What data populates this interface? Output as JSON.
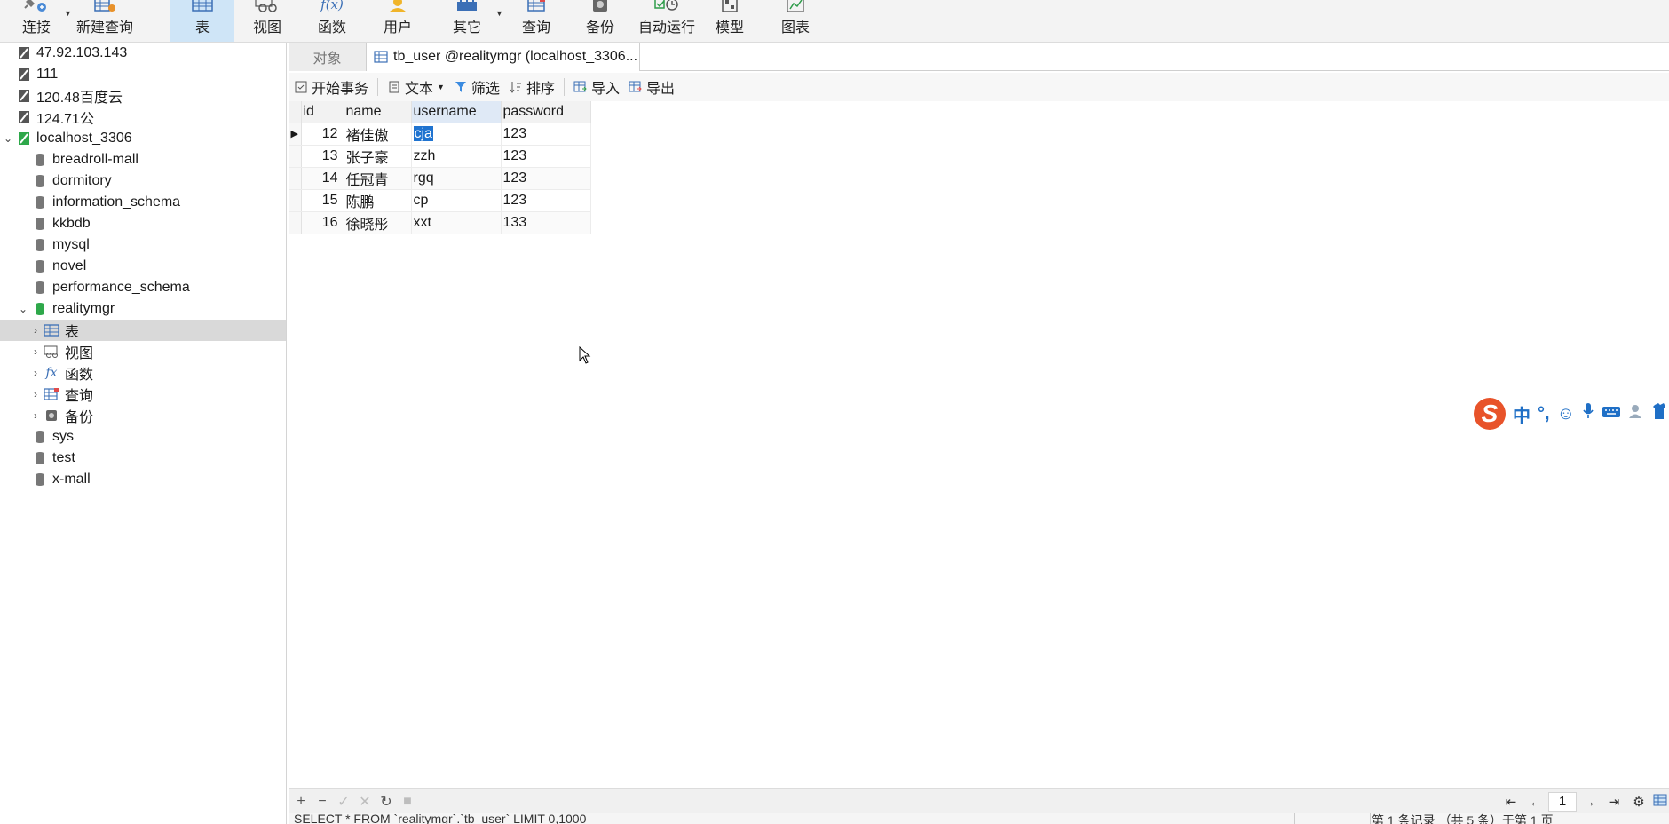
{
  "toolbar": {
    "items": [
      {
        "label": "连接",
        "icon": "plug-icon"
      },
      {
        "label": "新建查询",
        "icon": "new-query-icon"
      },
      {
        "label": "表",
        "icon": "table-icon",
        "active": true
      },
      {
        "label": "视图",
        "icon": "view-icon"
      },
      {
        "label": "函数",
        "icon": "function-icon"
      },
      {
        "label": "用户",
        "icon": "user-icon"
      },
      {
        "label": "其它",
        "icon": "other-icon"
      },
      {
        "label": "查询",
        "icon": "query-icon"
      },
      {
        "label": "备份",
        "icon": "backup-icon"
      },
      {
        "label": "自动运行",
        "icon": "autorun-icon"
      },
      {
        "label": "模型",
        "icon": "model-icon"
      },
      {
        "label": "图表",
        "icon": "chart-icon"
      }
    ],
    "func_glyph": "f(x)"
  },
  "sidebar": {
    "items": [
      {
        "label": "47.92.103.143"
      },
      {
        "label": "111"
      },
      {
        "label": "120.48百度云"
      },
      {
        "label": "124.71公"
      },
      {
        "label": "localhost_3306"
      },
      {
        "label": "breadroll-mall"
      },
      {
        "label": "dormitory"
      },
      {
        "label": "information_schema"
      },
      {
        "label": "kkbdb"
      },
      {
        "label": "mysql"
      },
      {
        "label": "novel"
      },
      {
        "label": "performance_schema"
      },
      {
        "label": "realitymgr"
      },
      {
        "label": "表"
      },
      {
        "label": "视图"
      },
      {
        "label": "函数"
      },
      {
        "label": "查询"
      },
      {
        "label": "备份"
      },
      {
        "label": "sys"
      },
      {
        "label": "test"
      },
      {
        "label": "x-mall"
      }
    ],
    "fx_glyph": "fx"
  },
  "tabs": {
    "objects": "对象",
    "active": "tb_user @realitymgr (localhost_3306..."
  },
  "subtoolbar": {
    "begin_tx": "开始事务",
    "text": "文本",
    "filter": "筛选",
    "sort": "排序",
    "import": "导入",
    "export": "导出"
  },
  "grid": {
    "columns": [
      "id",
      "name",
      "username",
      "password"
    ],
    "rows": [
      {
        "id": "12",
        "name": "褚佳傲",
        "username": "cja",
        "password": "123"
      },
      {
        "id": "13",
        "name": "张子豪",
        "username": "zzh",
        "password": "123"
      },
      {
        "id": "14",
        "name": "任冠青",
        "username": "rgq",
        "password": "123"
      },
      {
        "id": "15",
        "name": "陈鹏",
        "username": "cp",
        "password": "123"
      },
      {
        "id": "16",
        "name": "徐晓彤",
        "username": "xxt",
        "password": "133"
      }
    ]
  },
  "ime": {
    "logo": "S",
    "mode": "中",
    "punct": "°,"
  },
  "bottom": {
    "page": "1",
    "sql": "SELECT * FROM `realitymgr`.`tb_user` LIMIT 0,1000",
    "records": "第 1 条记录 （共 5 条）于第 1 页"
  }
}
